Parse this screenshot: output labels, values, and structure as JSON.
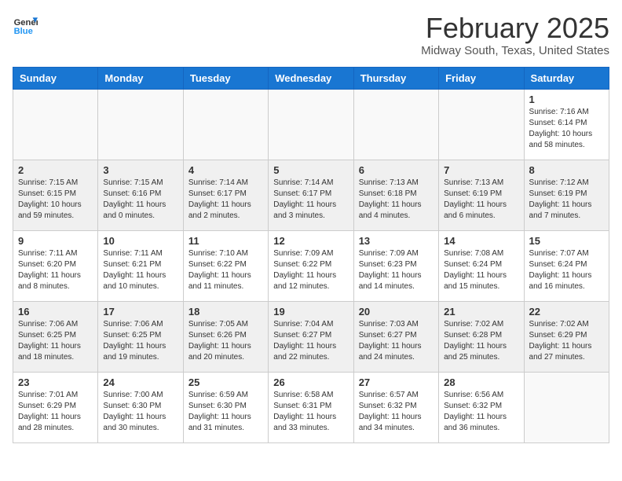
{
  "header": {
    "logo_line1": "General",
    "logo_line2": "Blue",
    "month_title": "February 2025",
    "location": "Midway South, Texas, United States"
  },
  "weekdays": [
    "Sunday",
    "Monday",
    "Tuesday",
    "Wednesday",
    "Thursday",
    "Friday",
    "Saturday"
  ],
  "weeks": [
    [
      {
        "day": "",
        "info": ""
      },
      {
        "day": "",
        "info": ""
      },
      {
        "day": "",
        "info": ""
      },
      {
        "day": "",
        "info": ""
      },
      {
        "day": "",
        "info": ""
      },
      {
        "day": "",
        "info": ""
      },
      {
        "day": "1",
        "info": "Sunrise: 7:16 AM\nSunset: 6:14 PM\nDaylight: 10 hours\nand 58 minutes."
      }
    ],
    [
      {
        "day": "2",
        "info": "Sunrise: 7:15 AM\nSunset: 6:15 PM\nDaylight: 10 hours\nand 59 minutes."
      },
      {
        "day": "3",
        "info": "Sunrise: 7:15 AM\nSunset: 6:16 PM\nDaylight: 11 hours\nand 0 minutes."
      },
      {
        "day": "4",
        "info": "Sunrise: 7:14 AM\nSunset: 6:17 PM\nDaylight: 11 hours\nand 2 minutes."
      },
      {
        "day": "5",
        "info": "Sunrise: 7:14 AM\nSunset: 6:17 PM\nDaylight: 11 hours\nand 3 minutes."
      },
      {
        "day": "6",
        "info": "Sunrise: 7:13 AM\nSunset: 6:18 PM\nDaylight: 11 hours\nand 4 minutes."
      },
      {
        "day": "7",
        "info": "Sunrise: 7:13 AM\nSunset: 6:19 PM\nDaylight: 11 hours\nand 6 minutes."
      },
      {
        "day": "8",
        "info": "Sunrise: 7:12 AM\nSunset: 6:19 PM\nDaylight: 11 hours\nand 7 minutes."
      }
    ],
    [
      {
        "day": "9",
        "info": "Sunrise: 7:11 AM\nSunset: 6:20 PM\nDaylight: 11 hours\nand 8 minutes."
      },
      {
        "day": "10",
        "info": "Sunrise: 7:11 AM\nSunset: 6:21 PM\nDaylight: 11 hours\nand 10 minutes."
      },
      {
        "day": "11",
        "info": "Sunrise: 7:10 AM\nSunset: 6:22 PM\nDaylight: 11 hours\nand 11 minutes."
      },
      {
        "day": "12",
        "info": "Sunrise: 7:09 AM\nSunset: 6:22 PM\nDaylight: 11 hours\nand 12 minutes."
      },
      {
        "day": "13",
        "info": "Sunrise: 7:09 AM\nSunset: 6:23 PM\nDaylight: 11 hours\nand 14 minutes."
      },
      {
        "day": "14",
        "info": "Sunrise: 7:08 AM\nSunset: 6:24 PM\nDaylight: 11 hours\nand 15 minutes."
      },
      {
        "day": "15",
        "info": "Sunrise: 7:07 AM\nSunset: 6:24 PM\nDaylight: 11 hours\nand 16 minutes."
      }
    ],
    [
      {
        "day": "16",
        "info": "Sunrise: 7:06 AM\nSunset: 6:25 PM\nDaylight: 11 hours\nand 18 minutes."
      },
      {
        "day": "17",
        "info": "Sunrise: 7:06 AM\nSunset: 6:25 PM\nDaylight: 11 hours\nand 19 minutes."
      },
      {
        "day": "18",
        "info": "Sunrise: 7:05 AM\nSunset: 6:26 PM\nDaylight: 11 hours\nand 20 minutes."
      },
      {
        "day": "19",
        "info": "Sunrise: 7:04 AM\nSunset: 6:27 PM\nDaylight: 11 hours\nand 22 minutes."
      },
      {
        "day": "20",
        "info": "Sunrise: 7:03 AM\nSunset: 6:27 PM\nDaylight: 11 hours\nand 24 minutes."
      },
      {
        "day": "21",
        "info": "Sunrise: 7:02 AM\nSunset: 6:28 PM\nDaylight: 11 hours\nand 25 minutes."
      },
      {
        "day": "22",
        "info": "Sunrise: 7:02 AM\nSunset: 6:29 PM\nDaylight: 11 hours\nand 27 minutes."
      }
    ],
    [
      {
        "day": "23",
        "info": "Sunrise: 7:01 AM\nSunset: 6:29 PM\nDaylight: 11 hours\nand 28 minutes."
      },
      {
        "day": "24",
        "info": "Sunrise: 7:00 AM\nSunset: 6:30 PM\nDaylight: 11 hours\nand 30 minutes."
      },
      {
        "day": "25",
        "info": "Sunrise: 6:59 AM\nSunset: 6:30 PM\nDaylight: 11 hours\nand 31 minutes."
      },
      {
        "day": "26",
        "info": "Sunrise: 6:58 AM\nSunset: 6:31 PM\nDaylight: 11 hours\nand 33 minutes."
      },
      {
        "day": "27",
        "info": "Sunrise: 6:57 AM\nSunset: 6:32 PM\nDaylight: 11 hours\nand 34 minutes."
      },
      {
        "day": "28",
        "info": "Sunrise: 6:56 AM\nSunset: 6:32 PM\nDaylight: 11 hours\nand 36 minutes."
      },
      {
        "day": "",
        "info": ""
      }
    ]
  ]
}
